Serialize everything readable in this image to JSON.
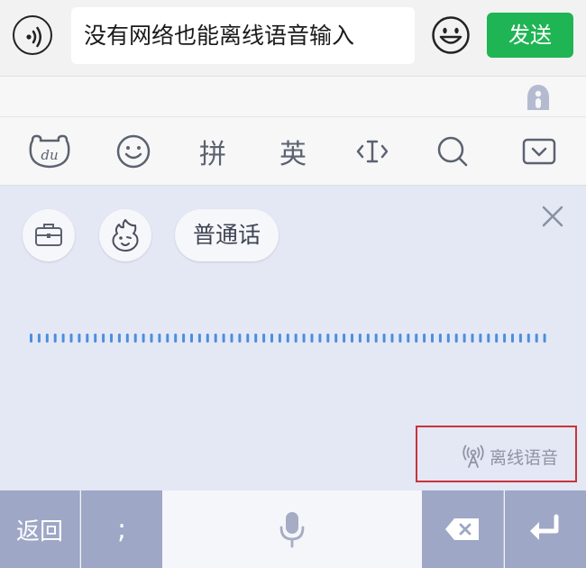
{
  "chat": {
    "message_text": "没有网络也能离线语音输入",
    "send_label": "发送"
  },
  "toolbar": {
    "items": [
      {
        "icon": "du-logo-icon",
        "label": "du"
      },
      {
        "icon": "emoji-icon",
        "label": ""
      },
      {
        "icon": "",
        "label": "拼"
      },
      {
        "icon": "",
        "label": "英"
      },
      {
        "icon": "cursor-move-icon",
        "label": ""
      },
      {
        "icon": "search-icon",
        "label": ""
      },
      {
        "icon": "collapse-keyboard-icon",
        "label": ""
      }
    ]
  },
  "voice_panel": {
    "language_label": "普通话",
    "offline_label": "离线语音",
    "highlight_color": "#c8343a",
    "wave_color": "#4a8fe0"
  },
  "keyboard": {
    "back_label": "返回",
    "punct_label": ";",
    "key_color": "#9ea7c6"
  },
  "colors": {
    "send_green": "#1fb454",
    "panel_bg": "#e4e7f4"
  }
}
